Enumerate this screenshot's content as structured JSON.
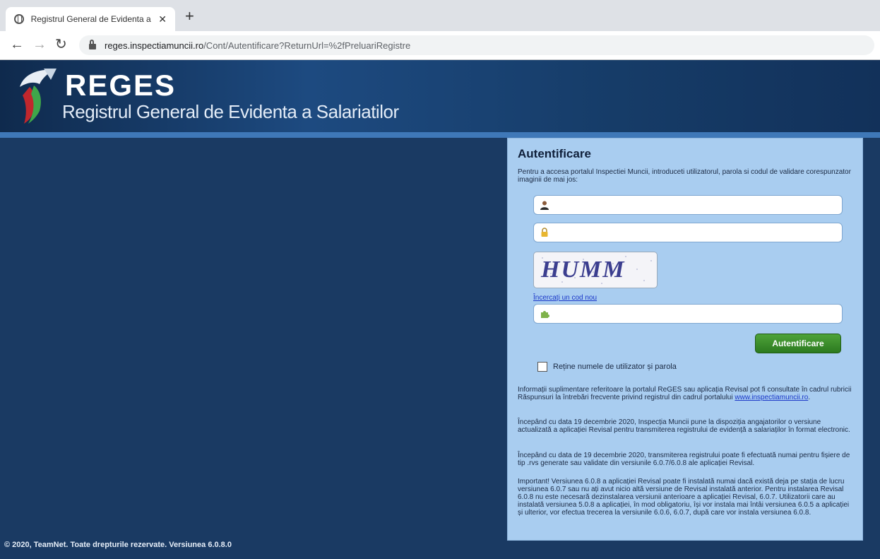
{
  "browser": {
    "tab_title": "Registrul General de Evidenta a S",
    "tab_close": "✕",
    "new_tab": "+",
    "url_host": "reges.inspectiamuncii.ro",
    "url_path": "/Cont/Autentificare?ReturnUrl=%2fPreluariRegistre"
  },
  "header": {
    "title": "REGES",
    "subtitle": "Registrul General de Evidenta a Salariatilor"
  },
  "login": {
    "title": "Autentificare",
    "intro": "Pentru a accesa portalul Inspectiei Muncii, introduceti utilizatorul, parola si codul de validare corespunzator imaginii de mai jos:",
    "username_placeholder": "",
    "password_placeholder": "",
    "captcha_text": "HUMM",
    "refresh_link": "Încercați un cod nou",
    "captcha_placeholder": "",
    "submit_label": "Autentificare",
    "remember_label": "Reține numele de utilizator și parola"
  },
  "info": {
    "p1_text": "Informații suplimentare referitoare la portalul ReGES sau aplicația Revisal pot fi consultate în cadrul rubricii Răspunsuri la întrebări frecvente privind registrul din cadrul portalului ",
    "p1_link": "www.inspectiamuncii.ro",
    "p1_end": ".",
    "p2": "Începând cu data 19 decembrie 2020, Inspecția Muncii pune la dispoziția angajatorilor o versiune actualizată a aplicației Revisal pentru transmiterea registrului de evidență a salariaților în format electronic.",
    "p3": "Începând cu data de 19 decembrie 2020, transmiterea registrului poate fi efectuată numai pentru fișiere de tip .rvs generate sau validate din versiunile 6.0.7/6.0.8 ale aplicației Revisal.",
    "p4": "Important! Versiunea 6.0.8 a aplicației Revisal poate fi instalată numai dacă există deja pe stația de lucru versiunea 6.0.7 sau nu ați avut nicio altă versiune de Revisal instalată anterior. Pentru instalarea Revisal 6.0.8 nu este necesară dezinstalarea versiunii anterioare a aplicației Revisal, 6.0.7. Utilizatorii care au instalată versiunea 5.0.8 a aplicației, în mod obligatoriu, își vor instala mai întâi versiunea 6.0.5 a aplicației și ulterior, vor efectua trecerea la versiunile 6.0.6, 6.0.7, după care vor instala versiunea 6.0.8."
  },
  "footer": {
    "text": "© 2020, TeamNet. Toate drepturile rezervate. Versiunea 6.0.8.0"
  }
}
